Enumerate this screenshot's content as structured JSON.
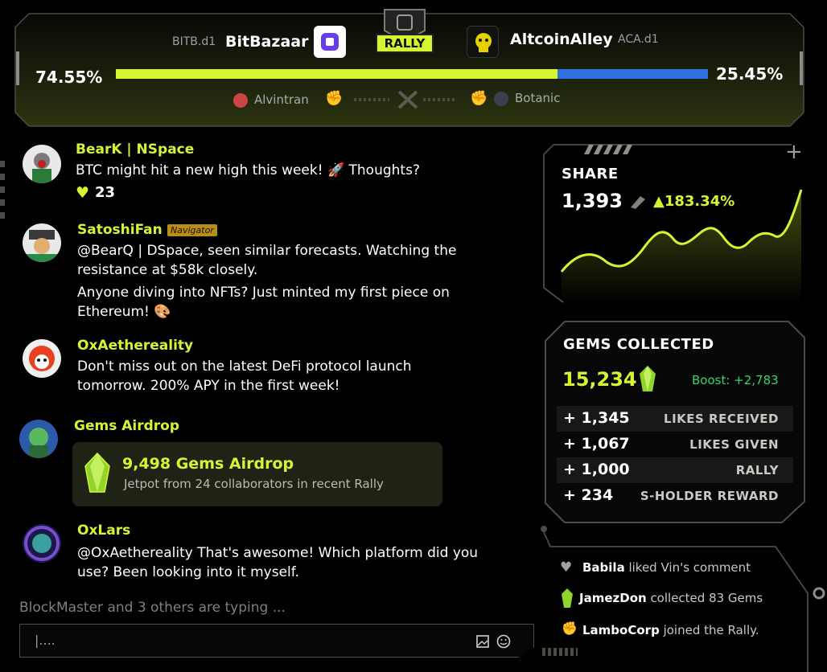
{
  "header": {
    "left_team": {
      "tag": "BITB.d1",
      "name": "BitBazaar",
      "percent": "74.55%",
      "share": 0.7455
    },
    "right_team": {
      "tag": "ACA.d1",
      "name": "AltcoinAlley",
      "percent": "25.45%"
    },
    "rally_badge": "RALLY",
    "left_player": "Alvintran",
    "right_player": "Botanic"
  },
  "feed": [
    {
      "username": "BearK | NSpace",
      "lines": [
        "BTC might hit a new high this week! 🚀 Thoughts?"
      ],
      "likes": "23"
    },
    {
      "username": "SatoshiFan",
      "badge": "Navigator",
      "lines": [
        "@BearQ | DSpace, seen similar forecasts. Watching the",
        "resistance at $58k closely.",
        "Anyone diving into NFTs? Just minted my first piece on",
        "Ethereum! 🎨"
      ]
    },
    {
      "username": "OxAethereality",
      "lines": [
        "Don't miss out on the latest DeFi protocol launch",
        "tomorrow. 200% APY in the first week!"
      ]
    },
    {
      "username": "Gems Airdrop",
      "card_title": "9,498 Gems Airdrop",
      "card_subtitle": "Jetpot from 24 collaborators in recent Rally"
    },
    {
      "username": "OxLars",
      "lines": [
        "@OxAethereality That's awesome! Which platform did you",
        "use? Been looking into it myself."
      ]
    }
  ],
  "typing_indicator": "BlockMaster and 3 others are typing ...",
  "chat_input": {
    "value": "|...."
  },
  "share": {
    "title": "SHARE",
    "value": "1,393",
    "change": "▲183.34%"
  },
  "gems": {
    "title": "GEMS COLLECTED",
    "total": "15,234",
    "boost": "Boost: +2,783",
    "rows": [
      {
        "value": "+ 1,345",
        "label": "LIKES RECEIVED"
      },
      {
        "value": "+ 1,067",
        "label": "LIKES GIVEN"
      },
      {
        "value": "+ 1,000",
        "label": "RALLY"
      },
      {
        "value": "+ 234",
        "label": "S-HOLDER REWARD"
      }
    ]
  },
  "activity": [
    {
      "actor": "Babila",
      "text": " liked Vin's comment"
    },
    {
      "actor": "JamezDon",
      "text": " collected 83 Gems"
    },
    {
      "actor": "LamboCorp",
      "text": " joined the Rally."
    }
  ],
  "colors": {
    "accent": "#d6f531",
    "right_team": "#2f6fe0",
    "boost": "#36d66b"
  }
}
